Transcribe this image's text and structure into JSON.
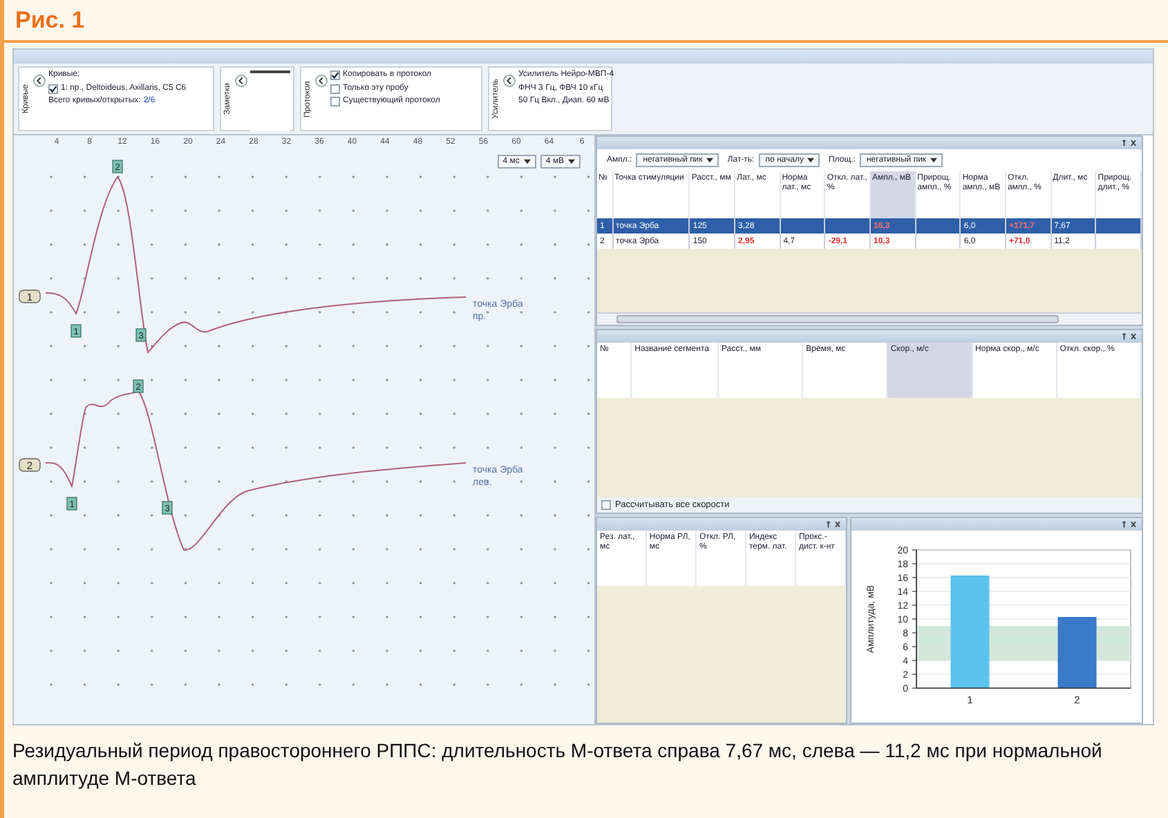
{
  "figure": {
    "label": "Рис. 1",
    "caption": "Резидуальный период правостороннего РППС: длительность М-ответа справа 7,67 мс, слева — 11,2 мс при нормальной амплитуде М-ответа"
  },
  "toolbar": [
    {
      "kind": "info",
      "title": "Кривые",
      "items": [
        {
          "kind": "text",
          "text": "Кривые:"
        },
        {
          "kind": "check",
          "text": "1: пр., Deltoideus, Axillaris, C5 C6",
          "checked": true
        },
        {
          "kind": "count",
          "text": "Всего кривых/открытых:",
          "value": "2/6"
        }
      ]
    },
    {
      "kind": "notes",
      "title": "Заметки"
    },
    {
      "kind": "info",
      "title": "Протокол",
      "items": [
        {
          "kind": "check",
          "text": "Копировать в протокол",
          "checked": true
        },
        {
          "kind": "check",
          "text": "Только эту пробу",
          "checked": false
        },
        {
          "kind": "check",
          "text": "Существующий протокол",
          "checked": false
        }
      ]
    },
    {
      "kind": "info",
      "title": "Усилитель",
      "items": [
        {
          "kind": "text",
          "text": "Усилитель Нейро-МВП-4"
        },
        {
          "kind": "text",
          "text": "ФНЧ 3 Гц, ФВЧ 10 кГц"
        },
        {
          "kind": "text",
          "text": "50 Гц Вкл., Диап. 60 мВ"
        }
      ]
    }
  ],
  "waveforms": {
    "ruler": [
      "4",
      "8",
      "12",
      "16",
      "20",
      "24",
      "28",
      "32",
      "36",
      "40",
      "44",
      "48",
      "52",
      "56",
      "60",
      "64",
      "6"
    ],
    "scales": [
      "4 мс",
      "4 мВ"
    ],
    "traces": [
      {
        "tag": "1",
        "label": [
          "точка Эрба",
          "пр."
        ],
        "markers": [
          "1",
          "2",
          "3"
        ]
      },
      {
        "tag": "2",
        "label": [
          "точка Эрба",
          "лев."
        ],
        "markers": [
          "1",
          "2",
          "3"
        ]
      }
    ]
  },
  "responses": {
    "controls": [
      {
        "label": "Ампл.:",
        "value": "негативный пик"
      },
      {
        "label": "Лат-ть:",
        "value": "по началу"
      },
      {
        "label": "Площ.:",
        "value": "негативный пик"
      }
    ],
    "columns": [
      {
        "text": "№",
        "selected": false
      },
      {
        "text": "Точка стимуляции",
        "selected": false
      },
      {
        "text": "Расст., мм",
        "selected": false
      },
      {
        "text": "Лат., мс",
        "selected": false
      },
      {
        "text": "Норма лат., мс",
        "selected": false
      },
      {
        "text": "Откл. лат., %",
        "selected": false
      },
      {
        "text": "Ампл., мВ",
        "selected": true
      },
      {
        "text": "Прирощ. ампл., %",
        "selected": false
      },
      {
        "text": "Норма ампл., мВ",
        "selected": false
      },
      {
        "text": "Откл. ампл., %",
        "selected": false
      },
      {
        "text": "Длит., мс",
        "selected": false
      },
      {
        "text": "Прирощ. длит., %",
        "selected": false
      }
    ],
    "rows": [
      {
        "selected": true,
        "cells": [
          {
            "text": "1",
            "flagged": false
          },
          {
            "text": "точка Эрба",
            "flagged": false
          },
          {
            "text": "125",
            "flagged": false
          },
          {
            "text": "3,28",
            "flagged": false
          },
          {},
          {},
          {
            "text": "16,3",
            "flagged": true
          },
          {},
          {
            "text": "6,0",
            "flagged": false
          },
          {
            "text": "+171,7",
            "flagged": true
          },
          {
            "text": "7,67",
            "flagged": false
          },
          {}
        ]
      },
      {
        "selected": false,
        "cells": [
          {
            "text": "2",
            "flagged": false
          },
          {
            "text": "точка Эрба",
            "flagged": false
          },
          {
            "text": "150",
            "flagged": false
          },
          {
            "text": "2,95",
            "flagged": true
          },
          {
            "text": "4,7",
            "flagged": false
          },
          {
            "text": "-29,1",
            "flagged": true
          },
          {
            "text": "10,3",
            "flagged": true
          },
          {},
          {
            "text": "6,0",
            "flagged": false
          },
          {
            "text": "+71,0",
            "flagged": true
          },
          {
            "text": "11,2",
            "flagged": false
          },
          {}
        ]
      }
    ]
  },
  "segments": {
    "columns": [
      {
        "text": "№",
        "selected": false
      },
      {
        "text": "Название сегмента",
        "selected": false
      },
      {
        "text": "Расст., мм",
        "selected": false
      },
      {
        "text": "Время, мс",
        "selected": false
      },
      {
        "text": "Скор., м/с",
        "selected": true
      },
      {
        "text": "Норма скор., м/с",
        "selected": false
      },
      {
        "text": "Откл. скор., %",
        "selected": false
      }
    ],
    "option": {
      "label": "Рассчитывать все скорости",
      "checked": false
    }
  },
  "residual": {
    "columns": [
      {
        "text": "Рез. лат., мс",
        "selected": false
      },
      {
        "text": "Норма РЛ, мс",
        "selected": false
      },
      {
        "text": "Откл. РЛ, %",
        "selected": false
      },
      {
        "text": "Индекс терм. лат.",
        "selected": false
      },
      {
        "text": "Прокс.-дист. к-нт",
        "selected": false
      }
    ]
  },
  "amplitude_chart": {
    "chart_data": {
      "type": "bar",
      "ylabel": "Амплитуда, мВ",
      "categories": [
        "1",
        "2"
      ],
      "ylim": [
        0,
        20
      ],
      "yticks": [
        0,
        2,
        4,
        6,
        8,
        10,
        12,
        14,
        16,
        18,
        20
      ],
      "grid": true,
      "series": [
        {
          "color": "#5bc3ee",
          "values": [
            16.3,
            null
          ]
        },
        {
          "color": "#3a7bc8",
          "values": [
            null,
            10.3
          ]
        }
      ],
      "bands": [
        {
          "axis": "y",
          "from": 4,
          "to": 9,
          "color": "#d3e8dc"
        }
      ]
    }
  }
}
